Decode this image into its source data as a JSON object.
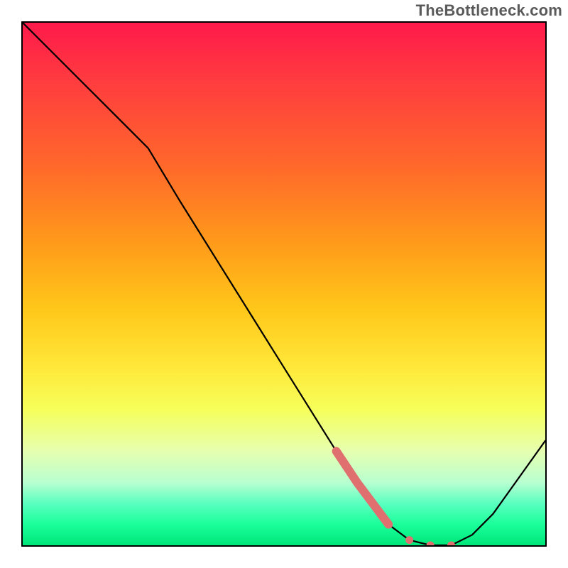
{
  "watermark": "TheBottleneck.com",
  "chart_data": {
    "type": "line",
    "title": "",
    "xlabel": "",
    "ylabel": "",
    "xlim": [
      0,
      100
    ],
    "ylim": [
      0,
      100
    ],
    "grid": false,
    "legend": false,
    "series": [
      {
        "name": "bottleneck-curve",
        "color": "#000000",
        "x": [
          0,
          10,
          20,
          24,
          30,
          40,
          50,
          60,
          64,
          70,
          74,
          78,
          82,
          86,
          90,
          100
        ],
        "values": [
          100,
          90,
          80,
          76,
          66,
          50,
          34,
          18,
          12,
          4,
          1,
          0,
          0,
          2,
          6,
          20
        ]
      }
    ],
    "highlight": {
      "name": "salmon-segment",
      "color": "#e07070",
      "x": [
        60,
        64,
        70,
        74,
        78,
        82
      ],
      "values": [
        18,
        12,
        4,
        1,
        0,
        0
      ],
      "dots_after": [
        {
          "x": 74,
          "y": 1
        },
        {
          "x": 78,
          "y": 0
        },
        {
          "x": 82,
          "y": 0
        }
      ]
    },
    "gradient_stops": [
      {
        "pct": 0,
        "color": "#ff1a4b"
      },
      {
        "pct": 12,
        "color": "#ff3e3e"
      },
      {
        "pct": 28,
        "color": "#ff6a2a"
      },
      {
        "pct": 42,
        "color": "#ff9a1a"
      },
      {
        "pct": 55,
        "color": "#ffc81a"
      },
      {
        "pct": 66,
        "color": "#ffe83a"
      },
      {
        "pct": 74,
        "color": "#f6ff5a"
      },
      {
        "pct": 82,
        "color": "#e6ffb0"
      },
      {
        "pct": 88,
        "color": "#b8ffd0"
      },
      {
        "pct": 92,
        "color": "#5affc0"
      },
      {
        "pct": 96,
        "color": "#1aff9a"
      },
      {
        "pct": 100,
        "color": "#00e67a"
      }
    ]
  }
}
